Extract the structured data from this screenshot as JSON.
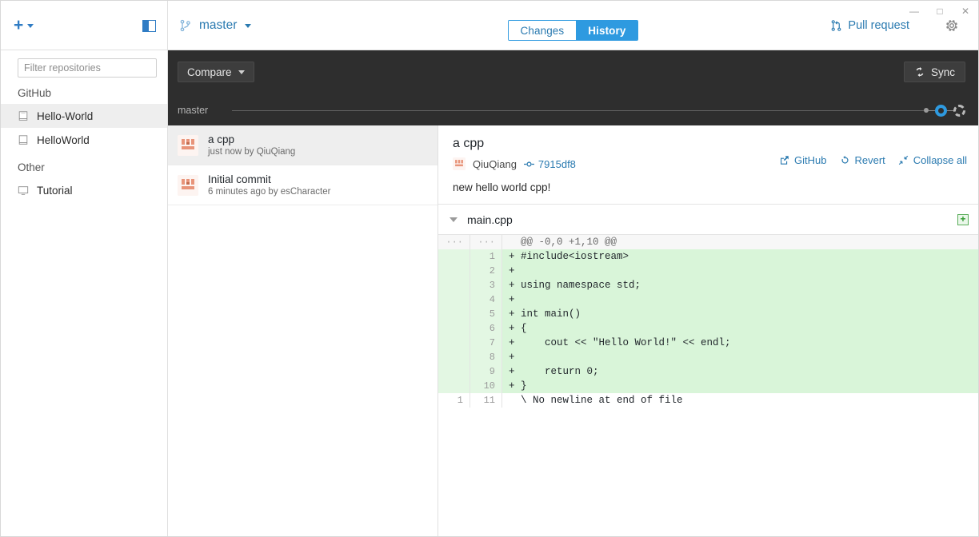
{
  "window": {
    "minimize_label": "—",
    "maximize_label": "□",
    "close_label": "✕"
  },
  "toolbar": {
    "add_repo_label": "+",
    "panel_toggle_name": "sidebar-toggle",
    "branch_name": "master",
    "pull_request_label": "Pull request",
    "tabs": [
      {
        "label": "Changes",
        "active": false
      },
      {
        "label": "History",
        "active": true
      }
    ]
  },
  "sidebar": {
    "filter_placeholder": "Filter repositories",
    "groups": [
      {
        "label": "GitHub",
        "items": [
          {
            "label": "Hello-World",
            "icon": "repo-icon",
            "selected": true
          },
          {
            "label": "HelloWorld",
            "icon": "repo-icon",
            "selected": false
          }
        ]
      },
      {
        "label": "Other",
        "items": [
          {
            "label": "Tutorial",
            "icon": "device-icon",
            "selected": false
          }
        ]
      }
    ]
  },
  "compare_bar": {
    "compare_label": "Compare",
    "sync_label": "Sync",
    "graph_branch_label": "master"
  },
  "commit_list": [
    {
      "title": "a cpp",
      "meta": "just now by QiuQiang",
      "selected": true
    },
    {
      "title": "Initial commit",
      "meta": "6 minutes ago by esCharacter",
      "selected": false
    }
  ],
  "commit_detail": {
    "title": "a cpp",
    "author": "QiuQiang",
    "sha": "7915df8",
    "description": "new hello world cpp!",
    "actions": [
      {
        "label": "GitHub",
        "icon": "external-link-icon"
      },
      {
        "label": "Revert",
        "icon": "revert-icon"
      },
      {
        "label": "Collapse all",
        "icon": "collapse-icon"
      }
    ]
  },
  "file_diff": {
    "file_name": "main.cpp",
    "badge": "+",
    "lines": [
      {
        "old": "···",
        "new": "···",
        "text": "  @@ -0,0 +1,10 @@",
        "type": "hunk"
      },
      {
        "old": "",
        "new": "1",
        "text": "+ #include<iostream>",
        "type": "add"
      },
      {
        "old": "",
        "new": "2",
        "text": "+ ",
        "type": "add"
      },
      {
        "old": "",
        "new": "3",
        "text": "+ using namespace std;",
        "type": "add"
      },
      {
        "old": "",
        "new": "4",
        "text": "+ ",
        "type": "add"
      },
      {
        "old": "",
        "new": "5",
        "text": "+ int main()",
        "type": "add"
      },
      {
        "old": "",
        "new": "6",
        "text": "+ {",
        "type": "add"
      },
      {
        "old": "",
        "new": "7",
        "text": "+     cout << \"Hello World!\" << endl;",
        "type": "add"
      },
      {
        "old": "",
        "new": "8",
        "text": "+ ",
        "type": "add"
      },
      {
        "old": "",
        "new": "9",
        "text": "+     return 0;",
        "type": "add"
      },
      {
        "old": "",
        "new": "10",
        "text": "+ }",
        "type": "add"
      },
      {
        "old": "1",
        "new": "11",
        "text": "  \\ No newline at end of file",
        "type": "context"
      }
    ]
  },
  "colors": {
    "accent": "#2e9ae0",
    "link": "#2a7ab0",
    "dark_bar": "#2e2e2e",
    "diff_add": "#d9f5d9",
    "diff_add_gutter": "#e3f7e3"
  }
}
